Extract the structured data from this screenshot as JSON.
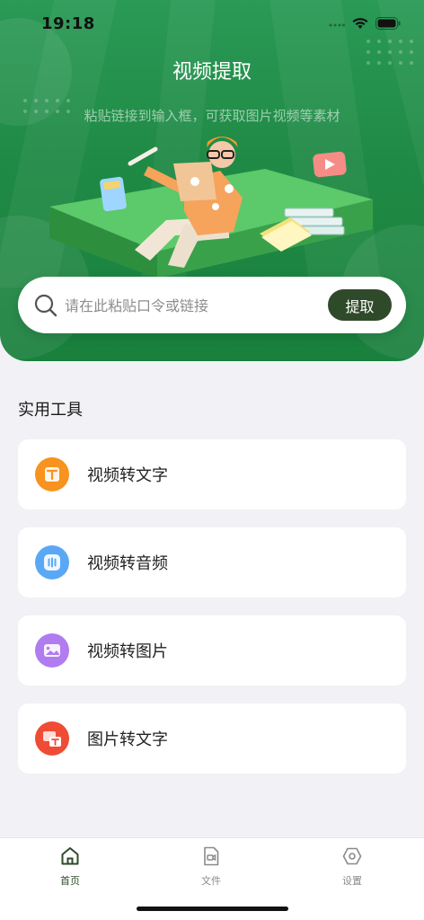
{
  "status_bar": {
    "time": "19:18"
  },
  "hero": {
    "title": "视频提取",
    "subtitle": "粘贴链接到输入框，可获取图片视频等素材"
  },
  "search": {
    "placeholder": "请在此粘贴口令或链接",
    "value": "",
    "button_label": "提取"
  },
  "tools": {
    "section_title": "实用工具",
    "items": [
      {
        "label": "视频转文字",
        "icon": "text-icon",
        "color": "#f7931e"
      },
      {
        "label": "视频转音频",
        "icon": "audio-icon",
        "color": "#5aa8f5"
      },
      {
        "label": "视频转图片",
        "icon": "image-icon",
        "color": "#b07cf0"
      },
      {
        "label": "图片转文字",
        "icon": "image-to-text-icon",
        "color": "#ef4b35"
      }
    ]
  },
  "tab_bar": {
    "items": [
      {
        "label": "首页",
        "icon": "home-icon",
        "active": true
      },
      {
        "label": "文件",
        "icon": "file-icon",
        "active": false
      },
      {
        "label": "设置",
        "icon": "settings-icon",
        "active": false
      }
    ]
  },
  "colors": {
    "brand_green": "#1f8a45",
    "button_dark_green": "#2f4a2a",
    "active_tab": "#2f4a2a",
    "inactive_tab": "#8a8a8a"
  }
}
